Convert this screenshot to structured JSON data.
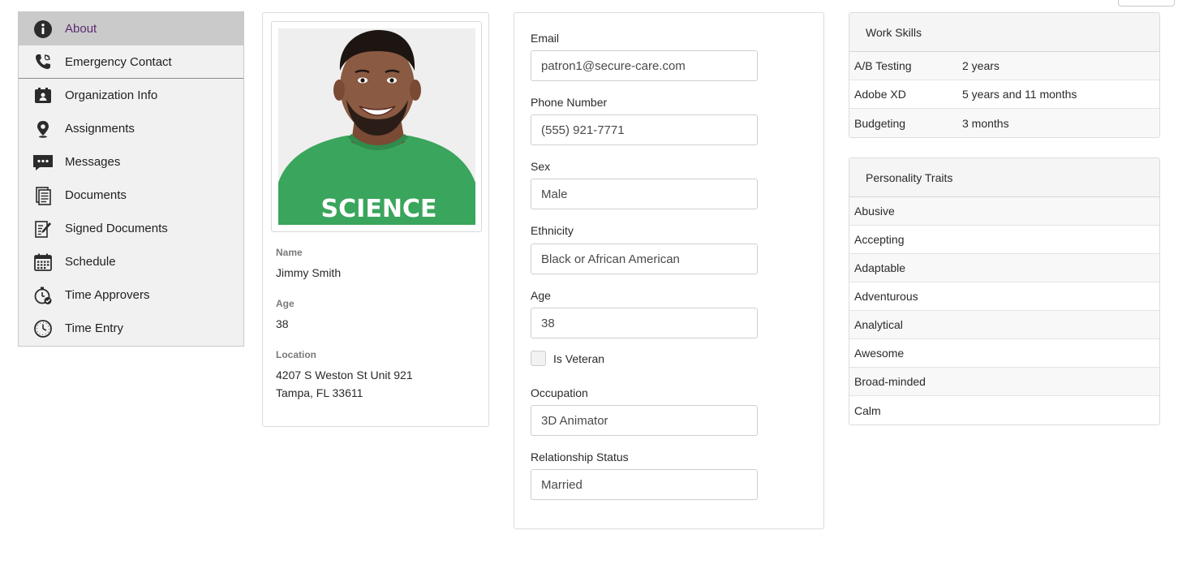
{
  "sidebar": {
    "items": [
      {
        "label": "About",
        "icon": "info-icon"
      },
      {
        "label": "Emergency Contact",
        "icon": "phone-icon"
      },
      {
        "label": "Organization Info",
        "icon": "id-badge-icon"
      },
      {
        "label": "Assignments",
        "icon": "map-pin-icon"
      },
      {
        "label": "Messages",
        "icon": "chat-icon"
      },
      {
        "label": "Documents",
        "icon": "document-icon"
      },
      {
        "label": "Signed Documents",
        "icon": "signed-document-icon"
      },
      {
        "label": "Schedule",
        "icon": "calendar-icon"
      },
      {
        "label": "Time Approvers",
        "icon": "stopwatch-check-icon"
      },
      {
        "label": "Time Entry",
        "icon": "clock-icon"
      }
    ]
  },
  "profile": {
    "name_label": "Name",
    "name": "Jimmy Smith",
    "age_label": "Age",
    "age": "38",
    "location_label": "Location",
    "location_line1": "4207 S Weston St Unit 921",
    "location_line2": "Tampa, FL 33611",
    "photo_shirt_text": "SCIENCE"
  },
  "form": {
    "email_label": "Email",
    "email": "patron1@secure-care.com",
    "phone_label": "Phone Number",
    "phone": "(555) 921-7771",
    "sex_label": "Sex",
    "sex": "Male",
    "ethnicity_label": "Ethnicity",
    "ethnicity": "Black or African American",
    "age_label": "Age",
    "age": "38",
    "veteran_label": "Is Veteran",
    "occupation_label": "Occupation",
    "occupation": "3D Animator",
    "relationship_label": "Relationship Status",
    "relationship": "Married"
  },
  "work_skills": {
    "title": "Work Skills",
    "rows": [
      {
        "skill": "A/B Testing",
        "duration": "2 years"
      },
      {
        "skill": "Adobe XD",
        "duration": "5 years and 11 months"
      },
      {
        "skill": "Budgeting",
        "duration": "3 months"
      }
    ]
  },
  "personality": {
    "title": "Personality Traits",
    "traits": [
      "Abusive",
      "Accepting",
      "Adaptable",
      "Adventurous",
      "Analytical",
      "Awesome",
      "Broad-minded",
      "Calm"
    ]
  },
  "colors": {
    "active_text": "#5b2a6f",
    "active_bg": "#cacaca",
    "sidebar_bg": "#f1f1f1",
    "shirt_green": "#3aa55c"
  }
}
